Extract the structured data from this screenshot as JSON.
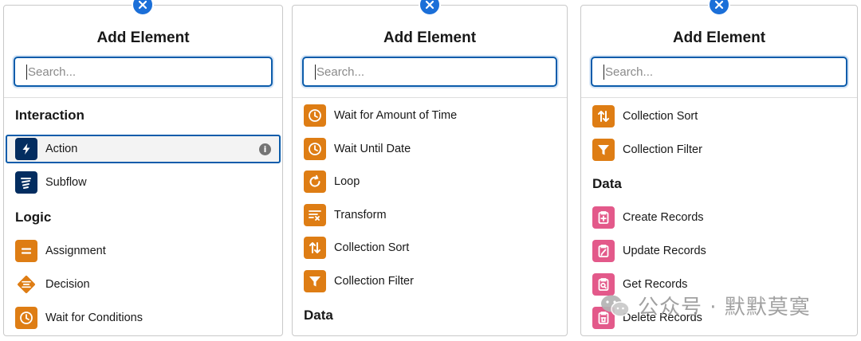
{
  "panels": [
    {
      "title": "Add Element",
      "search_placeholder": "Search...",
      "sections": {
        "interaction": "Interaction",
        "logic": "Logic"
      },
      "items": {
        "action": "Action",
        "subflow": "Subflow",
        "assignment": "Assignment",
        "decision": "Decision",
        "wait_for_conditions": "Wait for Conditions"
      }
    },
    {
      "title": "Add Element",
      "search_placeholder": "Search...",
      "sections": {
        "data": "Data"
      },
      "items": {
        "wait_for_amount_of_time": "Wait for Amount of Time",
        "wait_until_date": "Wait Until Date",
        "loop": "Loop",
        "transform": "Transform",
        "collection_sort": "Collection Sort",
        "collection_filter": "Collection Filter"
      }
    },
    {
      "title": "Add Element",
      "search_placeholder": "Search...",
      "sections": {
        "data": "Data"
      },
      "items": {
        "collection_sort": "Collection Sort",
        "collection_filter": "Collection Filter",
        "create_records": "Create Records",
        "update_records": "Update Records",
        "get_records": "Get Records",
        "delete_records": "Delete Records"
      }
    }
  ],
  "info_icon_glyph": "i",
  "watermark": {
    "text": "公众号 · 默默莫寞",
    "icon": "wechat-icon"
  },
  "colors": {
    "accent": "#0b5cab",
    "close_button": "#1b6fd8",
    "orange": "#de7d14",
    "navy": "#032d60",
    "pink": "#e3598a"
  }
}
